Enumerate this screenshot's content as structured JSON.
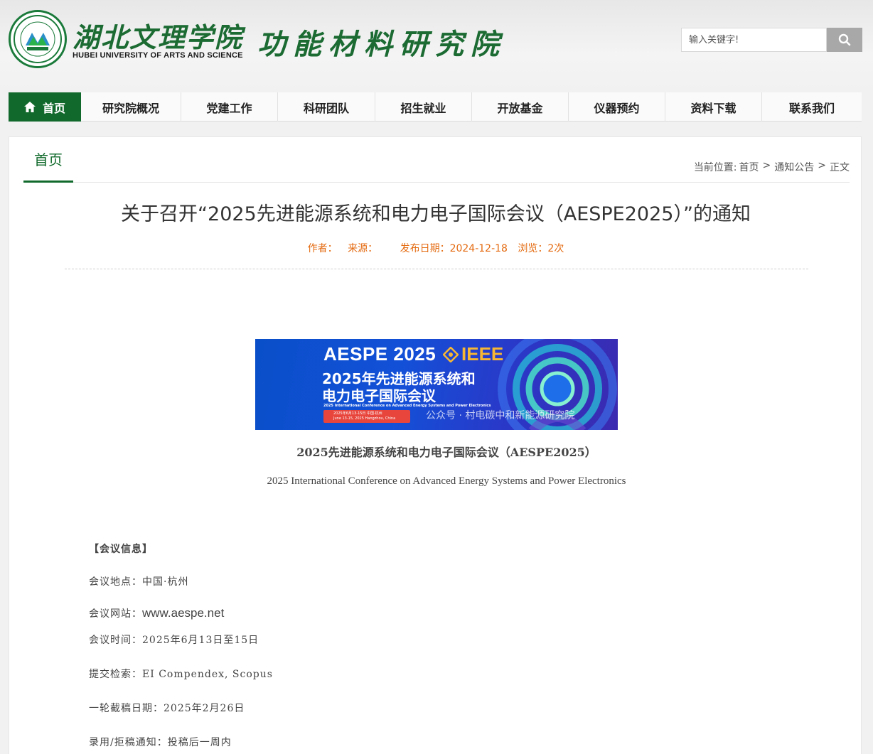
{
  "header": {
    "school_name_cn": "湖北文理学院",
    "school_name_en": "HUBEI UNIVERSITY OF ARTS AND SCIENCE",
    "institute_name_cn": "功能材料研究院",
    "seal_icon": "school-seal-icon"
  },
  "search": {
    "placeholder": "输入关键字!",
    "button_icon": "search-icon"
  },
  "nav": {
    "items": [
      {
        "label": "首页",
        "active": true
      },
      {
        "label": "研究院概况"
      },
      {
        "label": "党建工作"
      },
      {
        "label": "科研团队"
      },
      {
        "label": "招生就业"
      },
      {
        "label": "开放基金"
      },
      {
        "label": "仪器预约"
      },
      {
        "label": "资料下载"
      },
      {
        "label": "联系我们"
      }
    ]
  },
  "section": {
    "title": "首页",
    "breadcrumb_prefix": "当前位置:",
    "breadcrumb": [
      "首页",
      "通知公告",
      "正文"
    ],
    "breadcrumb_sep": ">"
  },
  "article": {
    "title": "关于召开“2025先进能源系统和电力电子国际会议（AESPE2025）”的通知",
    "author_label": "作者：",
    "source_label": "来源：",
    "date_label": "发布日期：2024-12-18",
    "views_label": "浏览：2次"
  },
  "banner": {
    "title": "AESPE 2025",
    "ieee": "IEEE",
    "cn_line1": "2025年先进能源系统和",
    "cn_line2": "电力电子国际会议",
    "en_line": "2025 International Conference on Advanced Energy Systems and Power Electronics",
    "date_strip": "2025年6月13-15日  中国·杭州",
    "date_strip_en": "June 13-15, 2025  Hangzhou, China",
    "watermark": "公众号 · 村电碳中和新能源研究院"
  },
  "captions": {
    "cn": "2025先进能源系统和电力电子国际会议（AESPE2025）",
    "en": "2025 International Conference on Advanced Energy Systems and Power Electronics"
  },
  "info": {
    "heading": "【会议信息】",
    "location": "会议地点：中国·杭州",
    "site_label": "会议网站：",
    "site": "www.aespe.net",
    "time": "会议时间：2025年6月13日至15日",
    "index": "提交检索：EI Compendex, Scopus",
    "deadline": "一轮截稿日期：2025年2月26日",
    "notify": "录用/拒稿通知：投稿后一周内"
  },
  "colors": {
    "brand_green": "#116a2c",
    "meta_orange": "#e46a10",
    "banner_blue": "#1350d8"
  }
}
